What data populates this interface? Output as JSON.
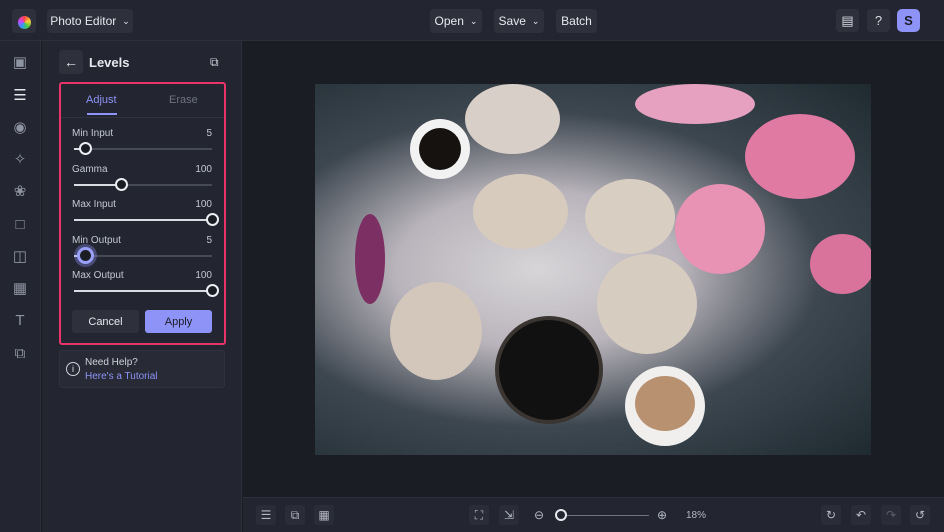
{
  "topbar": {
    "app_menu": "Photo Editor",
    "open": "Open",
    "save": "Save",
    "batch": "Batch",
    "avatar_initial": "S"
  },
  "panel": {
    "title": "Levels",
    "tabs": [
      "Adjust",
      "Erase"
    ],
    "sliders": [
      {
        "label": "Min Input",
        "value": "5",
        "position": 0.08
      },
      {
        "label": "Gamma",
        "value": "100",
        "position": 0.34
      },
      {
        "label": "Max Input",
        "value": "100",
        "position": 1.0
      },
      {
        "label": "Min Output",
        "value": "5",
        "position": 0.08
      },
      {
        "label": "Max Output",
        "value": "100",
        "position": 1.0
      }
    ],
    "cancel": "Cancel",
    "apply": "Apply",
    "help": {
      "title": "Need Help?",
      "link": "Here's a Tutorial"
    }
  },
  "bottombar": {
    "zoom": "18%",
    "zoom_position": 0.0
  },
  "colors": {
    "accent": "#8d93f7",
    "highlight": "#e8336b"
  }
}
